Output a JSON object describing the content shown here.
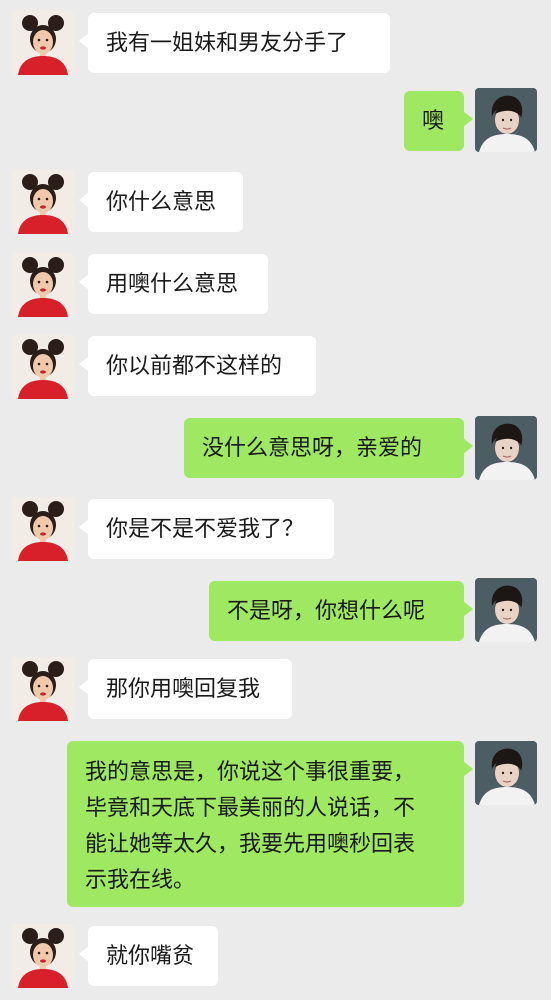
{
  "conversation": {
    "messages": [
      {
        "side": "left",
        "text": "我有一姐妹和男友分手了"
      },
      {
        "side": "right",
        "text": "噢"
      },
      {
        "side": "left",
        "text": "你什么意思"
      },
      {
        "side": "left",
        "text": "用噢什么意思"
      },
      {
        "side": "left",
        "text": "你以前都不这样的"
      },
      {
        "side": "right",
        "text": "没什么意思呀，亲爱的"
      },
      {
        "side": "left",
        "text": "你是不是不爱我了？"
      },
      {
        "side": "right",
        "text": "不是呀，你想什么呢"
      },
      {
        "side": "left",
        "text": "那你用噢回复我"
      },
      {
        "side": "right",
        "lines": [
          "我的意思是，你说这个事很重要，",
          "毕竟和天底下最美丽的人说话，不",
          "能让她等太久，我要先用噢秒回表",
          "示我在线。"
        ]
      },
      {
        "side": "left",
        "text": "就你嘴贫"
      }
    ]
  },
  "colors": {
    "background": "#ebebeb",
    "incoming_bubble": "#ffffff",
    "outgoing_bubble": "#9fe861"
  }
}
